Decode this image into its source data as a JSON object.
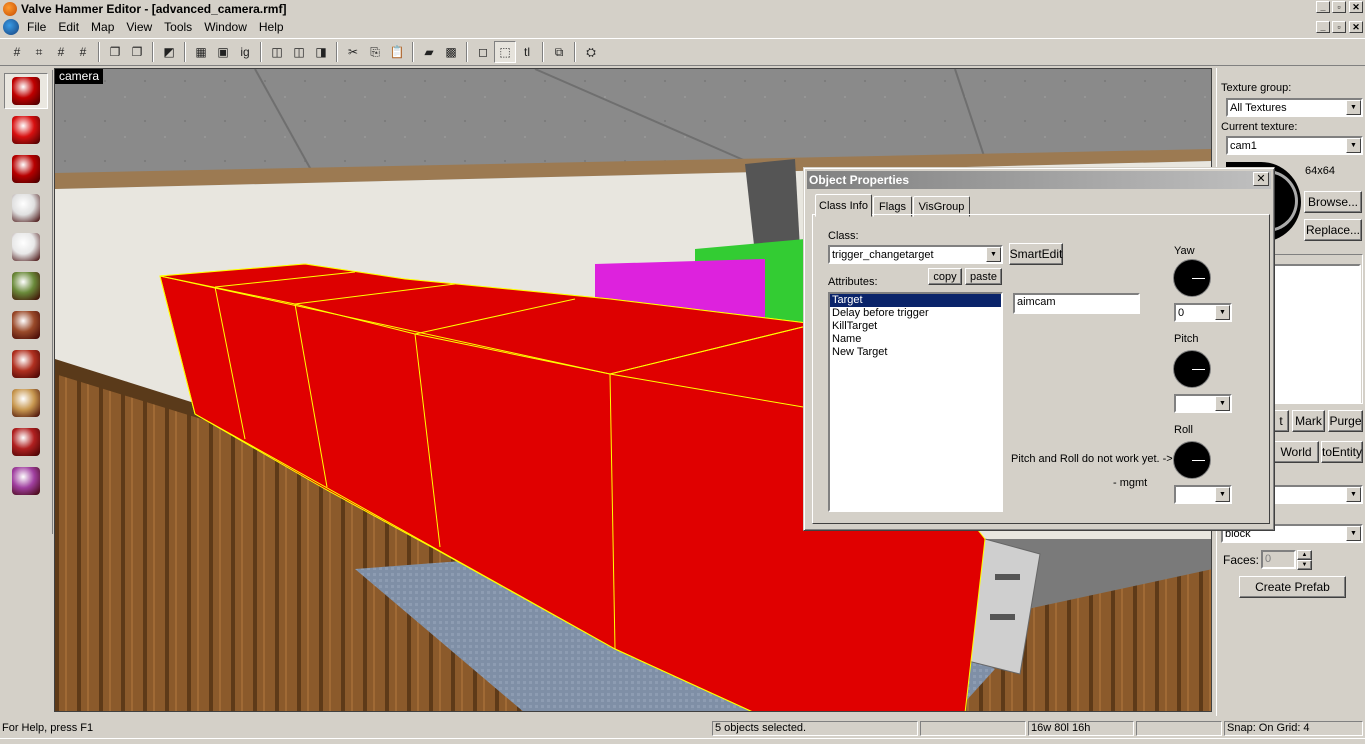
{
  "window": {
    "title": "Valve Hammer Editor - [advanced_camera.rmf]",
    "min_glyph": "_",
    "max_glyph": "▫",
    "close_glyph": "✕"
  },
  "menu": [
    "File",
    "Edit",
    "Map",
    "View",
    "Tools",
    "Window",
    "Help"
  ],
  "toolbar": {
    "items": [
      {
        "name": "grid-toggle-icon",
        "glyph": "#"
      },
      {
        "name": "grid-3d-icon",
        "glyph": "⌗"
      },
      {
        "name": "grid-smaller-icon",
        "glyph": "#"
      },
      {
        "name": "grid-larger-icon",
        "glyph": "#"
      },
      {
        "name": "sep"
      },
      {
        "name": "load-window-state-icon",
        "glyph": "❐"
      },
      {
        "name": "save-window-state-icon",
        "glyph": "❐"
      },
      {
        "name": "sep"
      },
      {
        "name": "undo-icon",
        "glyph": "◩"
      },
      {
        "name": "sep"
      },
      {
        "name": "compile-icon",
        "glyph": "▦"
      },
      {
        "name": "run-map-icon",
        "glyph": "▣"
      },
      {
        "name": "ignore-grouping-icon",
        "glyph": "ig"
      },
      {
        "name": "sep"
      },
      {
        "name": "hide-selected-icon",
        "glyph": "◫"
      },
      {
        "name": "hide-unselected-icon",
        "glyph": "◫"
      },
      {
        "name": "show-all-icon",
        "glyph": "◨"
      },
      {
        "name": "sep"
      },
      {
        "name": "cut-icon",
        "glyph": "✂"
      },
      {
        "name": "copy-icon",
        "glyph": "⎘"
      },
      {
        "name": "paste-icon",
        "glyph": "📋"
      },
      {
        "name": "sep"
      },
      {
        "name": "carve-icon",
        "glyph": "▰"
      },
      {
        "name": "hollow-icon",
        "glyph": "▩"
      },
      {
        "name": "sep"
      },
      {
        "name": "select-box-icon",
        "glyph": "◻"
      },
      {
        "name": "texture-lock-icon",
        "glyph": "⬚",
        "pressed": true
      },
      {
        "name": "texture-lock-text-icon",
        "glyph": "tl"
      },
      {
        "name": "sep"
      },
      {
        "name": "entity-report-icon",
        "glyph": "⧉"
      },
      {
        "name": "sep"
      },
      {
        "name": "lightmap-icon",
        "glyph": "⛭"
      }
    ]
  },
  "palette": [
    {
      "name": "selection-tool-icon",
      "active": true,
      "color": "#c00000"
    },
    {
      "name": "magnify-tool-icon",
      "color": "#d81010"
    },
    {
      "name": "camera-tool-icon",
      "color": "#b80000"
    },
    {
      "name": "entity-tool-icon",
      "color": "#e0e0e0"
    },
    {
      "name": "block-tool-icon",
      "color": "#e8e8e8"
    },
    {
      "name": "texture-application-icon",
      "color": "#6a8a3a"
    },
    {
      "name": "apply-texture-icon",
      "color": "#9a4a2a"
    },
    {
      "name": "decal-tool-icon",
      "color": "#b03020"
    },
    {
      "name": "clipping-tool-icon",
      "color": "#c89850"
    },
    {
      "name": "vertex-tool-icon",
      "color": "#b02020"
    },
    {
      "name": "path-tool-icon",
      "color": "#a040a0"
    }
  ],
  "viewport": {
    "label": "camera"
  },
  "right_panel": {
    "texture_group_label": "Texture group:",
    "texture_group_value": "All Textures",
    "current_texture_label": "Current texture:",
    "current_texture_value": "cam1",
    "texture_size": "64x64",
    "browse_label": "Browse...",
    "replace_label": "Replace...",
    "mark_label": "Mark",
    "purge_label": "Purge",
    "partial_button_label": "t",
    "world_label": "World",
    "to_entity_label": "toEntity",
    "primitive_value": "block",
    "faces_label": "Faces:",
    "faces_value": "0",
    "create_prefab_label": "Create Prefab"
  },
  "dialog": {
    "title": "Object Properties",
    "tabs": [
      "Class Info",
      "Flags",
      "VisGroup"
    ],
    "class_label": "Class:",
    "class_value": "trigger_changetarget",
    "smartedit_label": "SmartEdit",
    "attributes_label": "Attributes:",
    "copy_label": "copy",
    "paste_label": "paste",
    "attributes": [
      "Target",
      "Delay before trigger",
      "KillTarget",
      "Name",
      "New Target"
    ],
    "selected_attribute": 0,
    "value_field": "aimcam",
    "yaw_label": "Yaw",
    "yaw_value": "0",
    "pitch_label": "Pitch",
    "pitch_value": "",
    "roll_label": "Roll",
    "roll_value": "",
    "note_line1": "Pitch and Roll do not work yet. ->",
    "note_line2": "- mgmt"
  },
  "status": {
    "help": "For Help, press F1",
    "selection": "5 objects selected.",
    "size": "16w 80l 16h",
    "snap": "Snap: On Grid: 4"
  }
}
